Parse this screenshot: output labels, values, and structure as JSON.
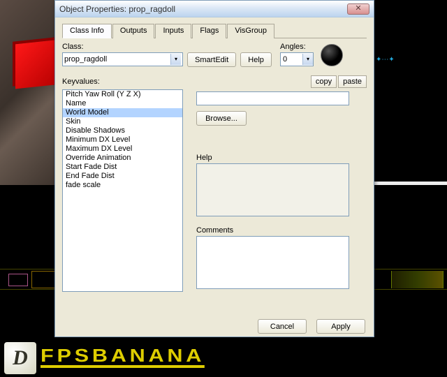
{
  "dialog": {
    "title": "Object Properties: prop_ragdoll",
    "tabs": [
      "Class Info",
      "Outputs",
      "Inputs",
      "Flags",
      "VisGroup"
    ],
    "class_label": "Class:",
    "class_value": "prop_ragdoll",
    "smartedit": "SmartEdit",
    "help": "Help",
    "angles_label": "Angles:",
    "angles_value": "0",
    "keyvalues_label": "Keyvalues:",
    "copy": "copy",
    "paste": "paste",
    "kv_items": [
      "Pitch Yaw Roll (Y Z X)",
      "Name",
      "World Model",
      "Skin",
      "Disable Shadows",
      "Minimum DX Level",
      "Maximum DX Level",
      "Override Animation",
      "Start Fade Dist",
      "End Fade Dist",
      "fade scale"
    ],
    "browse": "Browse...",
    "help_section": "Help",
    "comments_section": "Comments",
    "cancel": "Cancel",
    "apply": "Apply"
  },
  "brand": {
    "d": "D",
    "name": "FPSBANANA"
  }
}
